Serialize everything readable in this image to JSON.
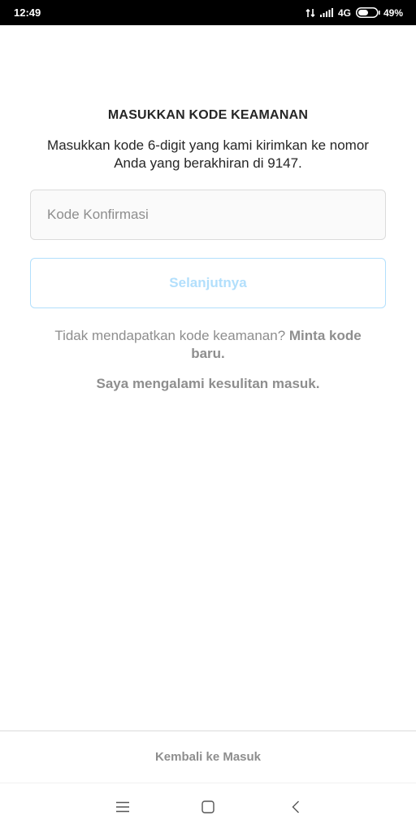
{
  "status_bar": {
    "time": "12:49",
    "network": "4G",
    "battery": "49%"
  },
  "verify": {
    "title": "MASUKKAN KODE KEAMANAN",
    "subtitle": "Masukkan kode 6-digit yang kami kirimkan ke nomor Anda yang berakhiran di 9147.",
    "code_placeholder": "Kode Konfirmasi",
    "code_value": "",
    "next_label": "Selanjutnya",
    "resend_prompt": "Tidak mendapatkan kode keamanan?",
    "resend_link": "Minta kode baru.",
    "trouble_label": "Saya mengalami kesulitan masuk."
  },
  "footer": {
    "back_to_login": "Kembali ke Masuk"
  },
  "colors": {
    "button_border": "#b2dffc",
    "button_text": "#b2dffc",
    "muted_text": "#8e8e8e",
    "field_background": "#fafafa"
  },
  "icons": [
    "signal-arrows-icon",
    "cell-signal-icon",
    "battery-icon",
    "menu-icon",
    "home-icon",
    "back-icon"
  ]
}
